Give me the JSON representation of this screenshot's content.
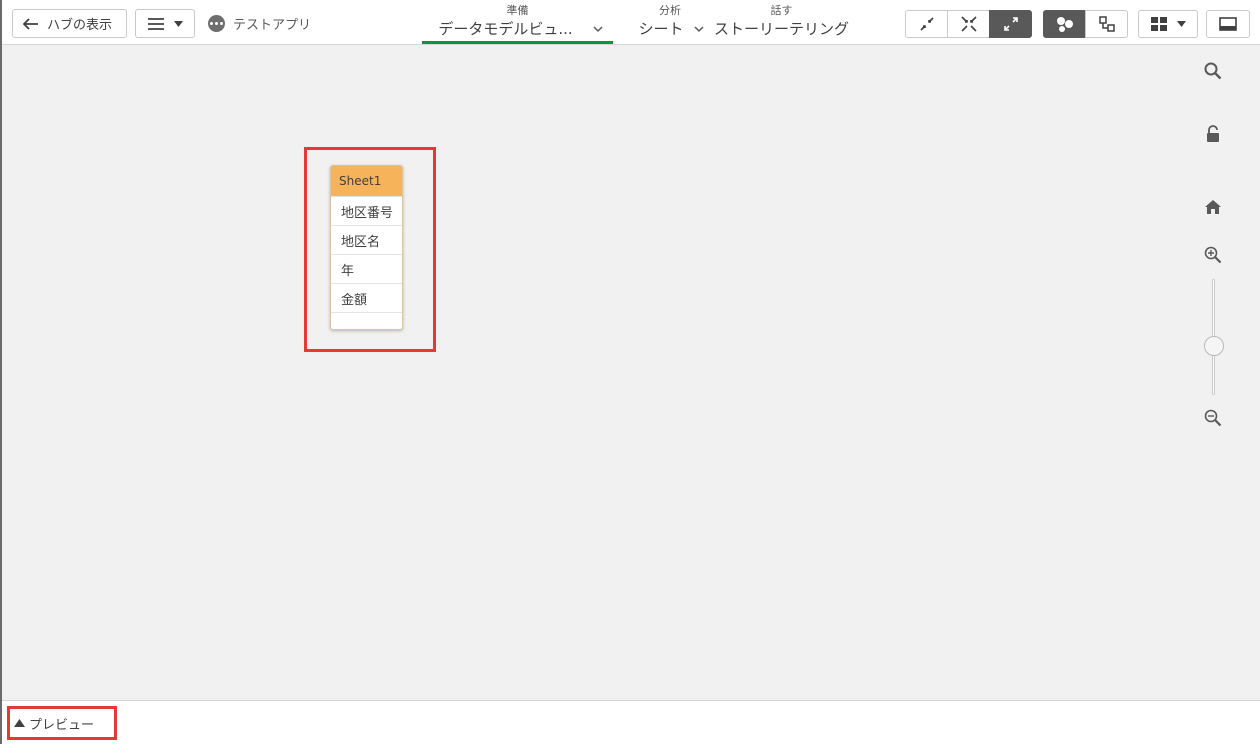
{
  "toolbar": {
    "hub_label": "ハブの表示",
    "app_name": "テストアプリ",
    "nav": [
      {
        "top": "準備",
        "main": "データモデルビュ..."
      },
      {
        "top": "分析",
        "main": "シート"
      },
      {
        "top": "話す",
        "main": "ストーリーテリング"
      }
    ],
    "active_nav_color": "#009845"
  },
  "canvas": {
    "table": {
      "name": "Sheet1",
      "fields": [
        "地区番号",
        "地区名",
        "年",
        "金額"
      ],
      "header_color": "#f7b35a"
    },
    "highlight_color": "#e53935"
  },
  "side_tools": [
    "search-icon",
    "unlock-icon",
    "home-icon",
    "zoom-in-icon",
    "zoom-out-icon"
  ],
  "bottom": {
    "preview_label": "プレビュー"
  }
}
